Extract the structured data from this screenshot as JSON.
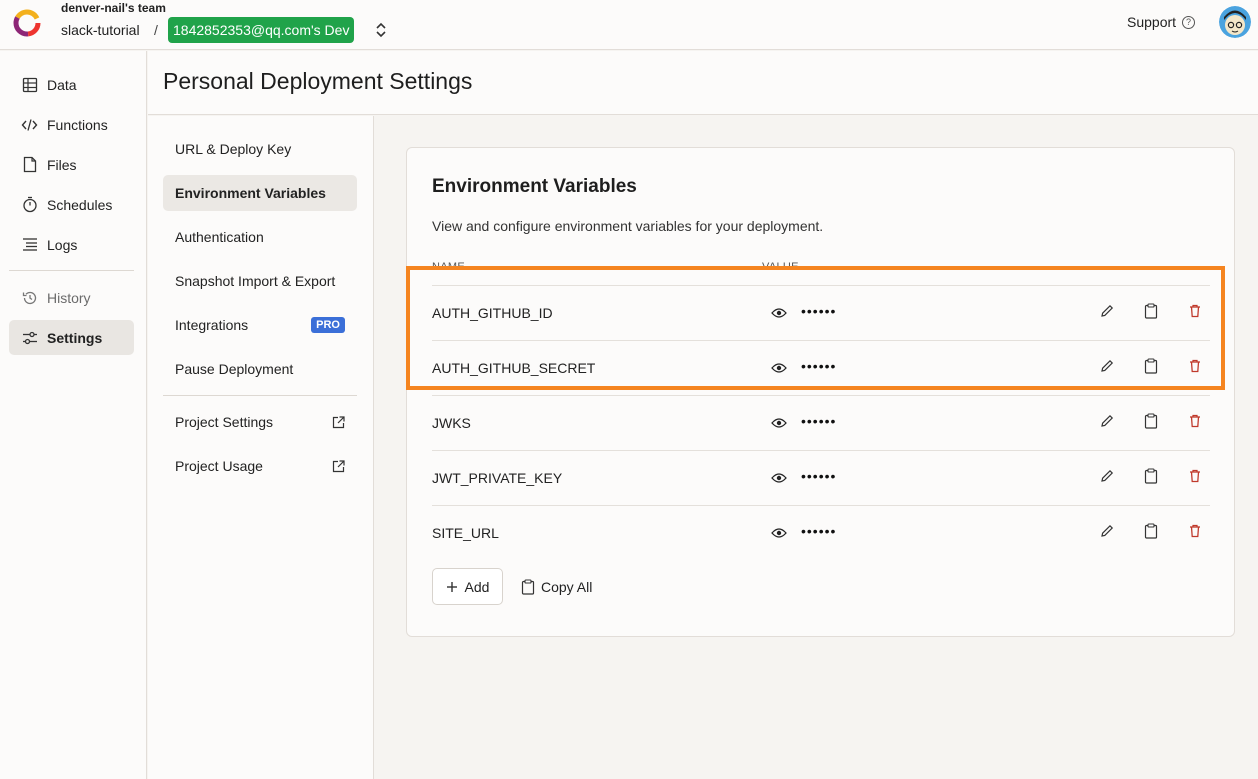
{
  "header": {
    "team_name": "denver-nail's team",
    "project_name": "slack-tutorial",
    "separator": "/",
    "deployment_label": "1842852353@qq.com's Dev",
    "support_label": "Support"
  },
  "sidebar": {
    "items": [
      {
        "label": "Data",
        "icon": "table-icon"
      },
      {
        "label": "Functions",
        "icon": "code-icon"
      },
      {
        "label": "Files",
        "icon": "file-icon"
      },
      {
        "label": "Schedules",
        "icon": "stopwatch-icon"
      },
      {
        "label": "Logs",
        "icon": "list-icon"
      },
      {
        "label": "History",
        "icon": "history-icon"
      },
      {
        "label": "Settings",
        "icon": "sliders-icon",
        "active": true
      }
    ]
  },
  "page": {
    "title": "Personal Deployment Settings"
  },
  "settings_nav": {
    "items": [
      {
        "label": "URL & Deploy Key"
      },
      {
        "label": "Environment Variables",
        "active": true
      },
      {
        "label": "Authentication"
      },
      {
        "label": "Snapshot Import & Export"
      },
      {
        "label": "Integrations",
        "badge": "PRO"
      },
      {
        "label": "Pause Deployment"
      },
      {
        "label": "Project Settings",
        "icon": "external-link-icon"
      },
      {
        "label": "Project Usage",
        "icon": "external-link-icon"
      }
    ]
  },
  "env": {
    "title": "Environment Variables",
    "description": "View and configure environment variables for your deployment.",
    "col_name": "NAME",
    "col_value": "VALUE",
    "rows": [
      {
        "name": "AUTH_GITHUB_ID",
        "value": "••••••"
      },
      {
        "name": "AUTH_GITHUB_SECRET",
        "value": "••••••"
      },
      {
        "name": "JWKS",
        "value": "••••••"
      },
      {
        "name": "JWT_PRIVATE_KEY",
        "value": "••••••"
      },
      {
        "name": "SITE_URL",
        "value": "••••••"
      }
    ],
    "add_label": "Add",
    "copy_all_label": "Copy All"
  },
  "colors": {
    "deployment_badge": "#20a34a",
    "pro_badge": "#3b6fd8",
    "highlight": "#f5841f",
    "delete": "#c0392b"
  }
}
